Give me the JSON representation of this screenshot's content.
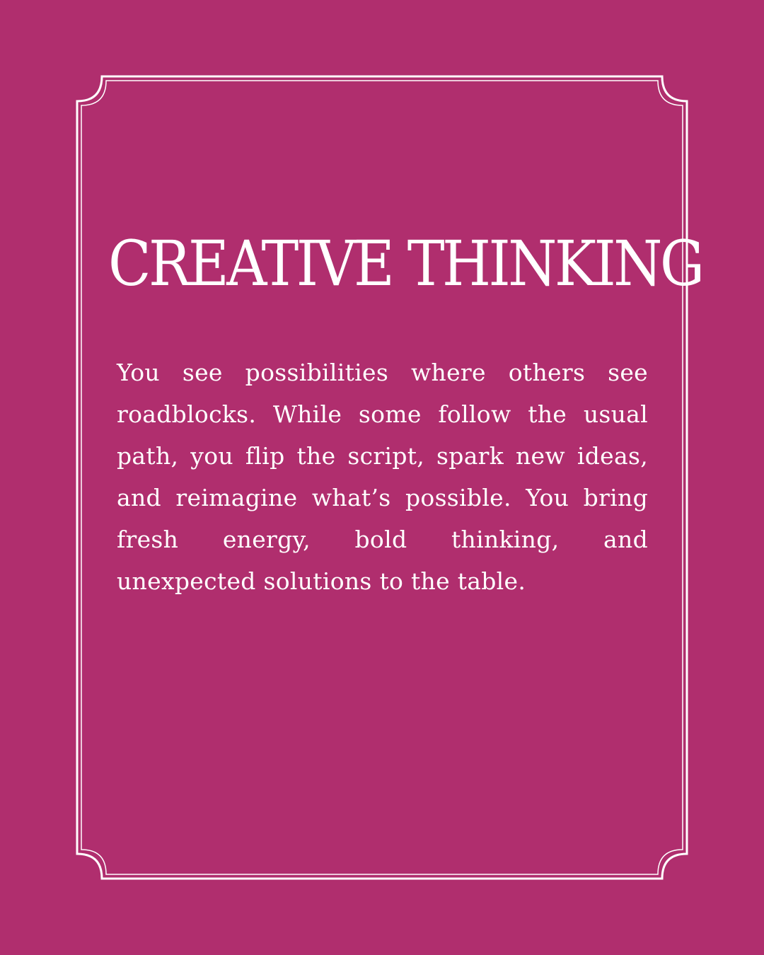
{
  "theme": {
    "background": "#b02e6e",
    "foreground": "#ffffff"
  },
  "card": {
    "title": "CREATIVE THINKING",
    "body": "You see possibilities where others see roadblocks. While some follow the usual path, you flip the script, spark new ideas, and reimagine what’s possible. You bring fresh energy, bold thinking, and unexpected solutions to the table."
  }
}
